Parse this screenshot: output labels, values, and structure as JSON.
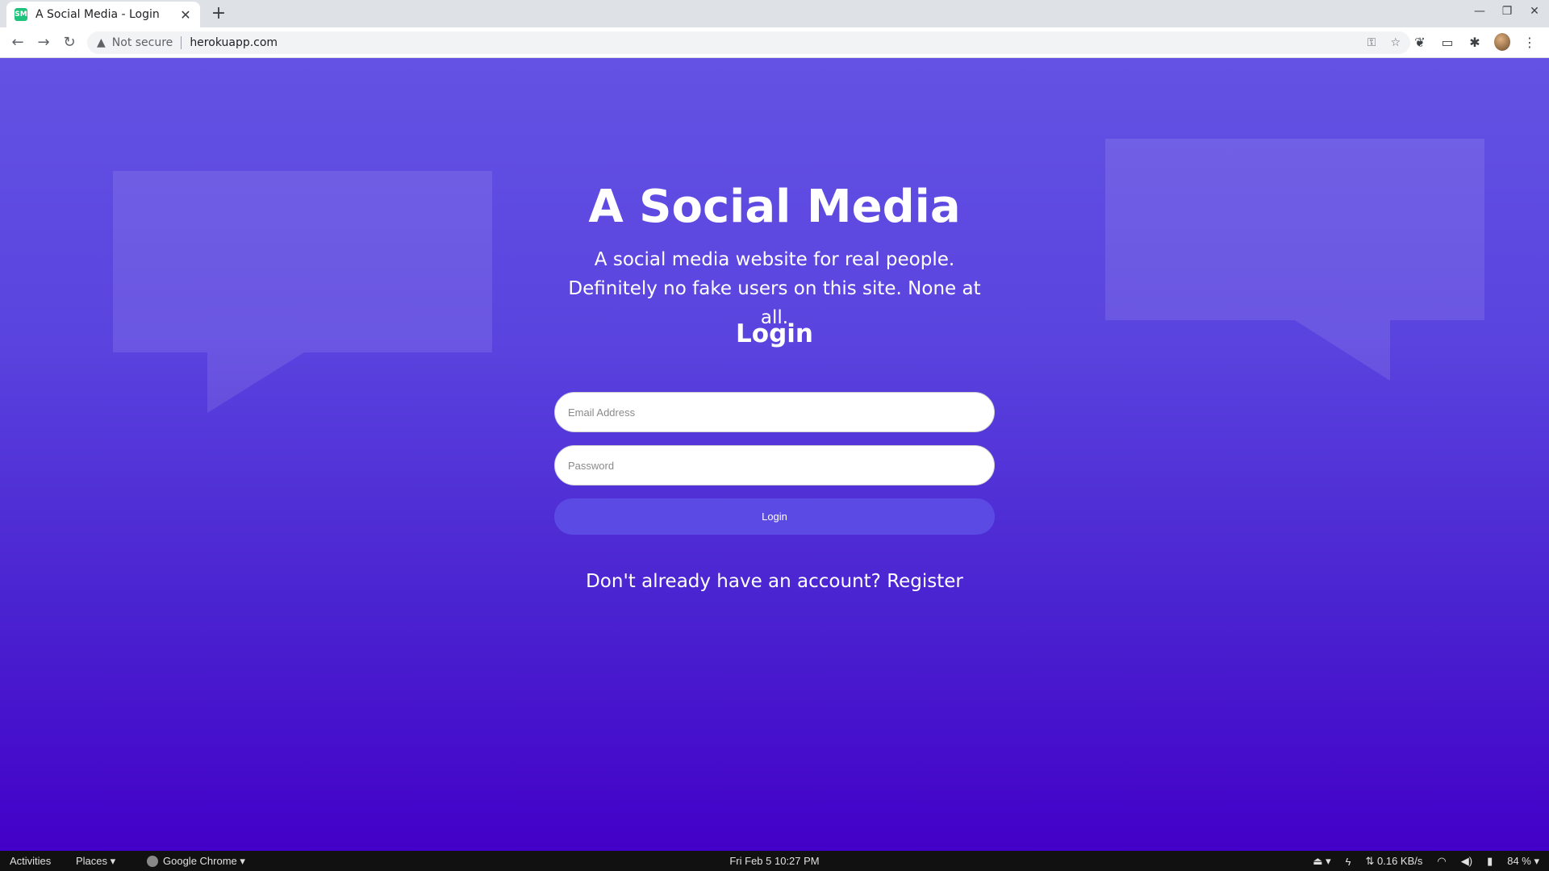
{
  "browser": {
    "tab_title": "A Social Media - Login",
    "favicon_text": "SM",
    "tab_close": "✕",
    "new_tab": "+",
    "window_controls": {
      "minimize": "—",
      "restore": "❐",
      "close": "✕"
    },
    "nav": {
      "back": "←",
      "forward": "→",
      "reload": "↻"
    },
    "security_warning": "Not secure",
    "url": "herokuapp.com",
    "omnibox_icons": {
      "key": "⚿",
      "star": "☆"
    },
    "extensions": {
      "ext1": "❦",
      "ext2": "▭",
      "puzzle": "✱",
      "menu": "⋮"
    }
  },
  "page": {
    "title": "A Social Media",
    "tagline": "A social media website for real people. Definitely no fake users on this site. None at all.",
    "login_heading": "Login",
    "email_placeholder": "Email Address",
    "password_placeholder": "Password",
    "login_button": "Login",
    "register_prompt": "Don't already have an account?",
    "register_link": "Register"
  },
  "taskbar": {
    "activities": "Activities",
    "places": "Places ▾",
    "app": "Google Chrome ▾",
    "clock": "Fri Feb 5  10:27 PM",
    "network_speed": "⇅ 0.16 KB/s",
    "battery": "84 % ▾",
    "icons": {
      "eject": "⏏ ▾",
      "power": "ϟ",
      "wifi": "◠",
      "volume": "◀)",
      "battery": "▮"
    }
  },
  "colors": {
    "page_gradient_top": "#6352e3",
    "page_gradient_bottom": "#4300c8",
    "login_button": "#5b4ae3",
    "favicon": "#1fc27a"
  }
}
